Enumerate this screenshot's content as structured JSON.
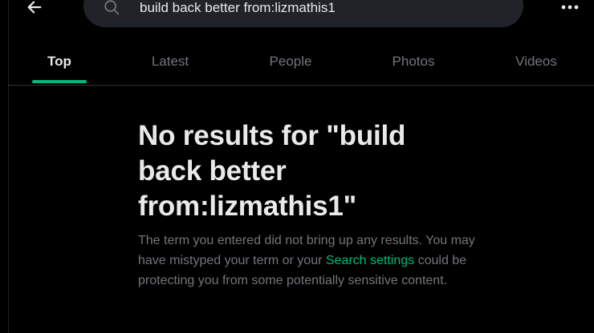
{
  "header": {
    "back_icon": "arrow-left-icon",
    "search": {
      "icon": "search-icon",
      "value": "build back better from:lizmathis1"
    },
    "more_icon": "more-horizontal-icon"
  },
  "tabs": [
    {
      "label": "Top",
      "active": true
    },
    {
      "label": "Latest",
      "active": false
    },
    {
      "label": "People",
      "active": false
    },
    {
      "label": "Photos",
      "active": false
    },
    {
      "label": "Videos",
      "active": false
    }
  ],
  "empty_state": {
    "title": "No results for \"build back better from:lizmathis1\"",
    "desc_before": "The term you entered did not bring up any results. You may have mistyped your term or your ",
    "link_text": "Search settings",
    "desc_after": " could be protecting you from some potentially sensitive content."
  },
  "colors": {
    "background": "#000000",
    "accent": "#00ba7c",
    "text_primary": "#e7e9ea",
    "text_secondary": "#71767b",
    "search_bg": "#202327"
  }
}
